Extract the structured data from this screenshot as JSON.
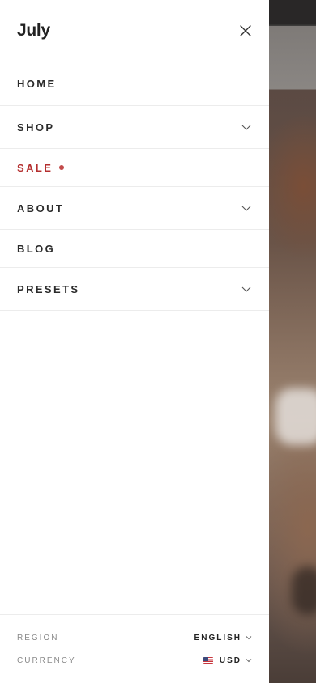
{
  "brand": {
    "name": "July"
  },
  "icons": {
    "close": "close-icon",
    "chevron": "chevron-down-icon",
    "flag": "us-flag-icon"
  },
  "colors": {
    "sale": "#b42f2f",
    "sale_dot": "#c24a4a",
    "text": "#2b2b2b",
    "muted": "#8a8a8a",
    "divider": "#ececec"
  },
  "nav": {
    "items": [
      {
        "label": "HOME",
        "has_submenu": false
      },
      {
        "label": "SHOP",
        "has_submenu": true
      },
      {
        "label": "SALE",
        "has_submenu": false,
        "highlight": true
      },
      {
        "label": "ABOUT",
        "has_submenu": true
      },
      {
        "label": "BLOG",
        "has_submenu": false
      },
      {
        "label": "PRESETS",
        "has_submenu": true
      }
    ]
  },
  "footer": {
    "region_label": "REGION",
    "region_value": "ENGLISH",
    "currency_label": "CURRENCY",
    "currency_value": "USD"
  }
}
